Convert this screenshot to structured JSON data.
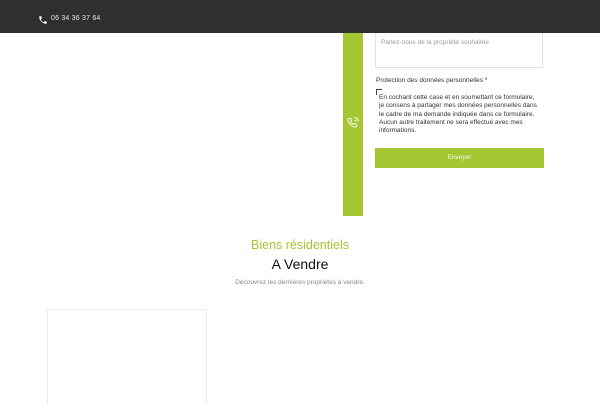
{
  "topbar": {
    "phone": "06 34 36 37 64",
    "icon": "phone-icon"
  },
  "form": {
    "message_placeholder": "Parlez-nous de la propriété souhaitée",
    "privacy_label": "Protection des données personnelles *",
    "consent_lines": [
      "En cochant cette case et en soumettant ce formulaire,",
      "je consens à partager mes données personnelles dans",
      "le cadre de ma demande indiquée dans ce formulaire.",
      "Aucun autre traitement ne sera effectué avec mes",
      "informations."
    ],
    "submit_label": "Envoyer",
    "contact_icon": "phone-call-icon"
  },
  "section": {
    "subtitle": "Biens résidentiels",
    "title": "A Vendre",
    "description": "Découvrez les dernières propriétés à vendre."
  },
  "colors": {
    "accent": "#a3c631",
    "topbar": "#2f2f2f"
  }
}
